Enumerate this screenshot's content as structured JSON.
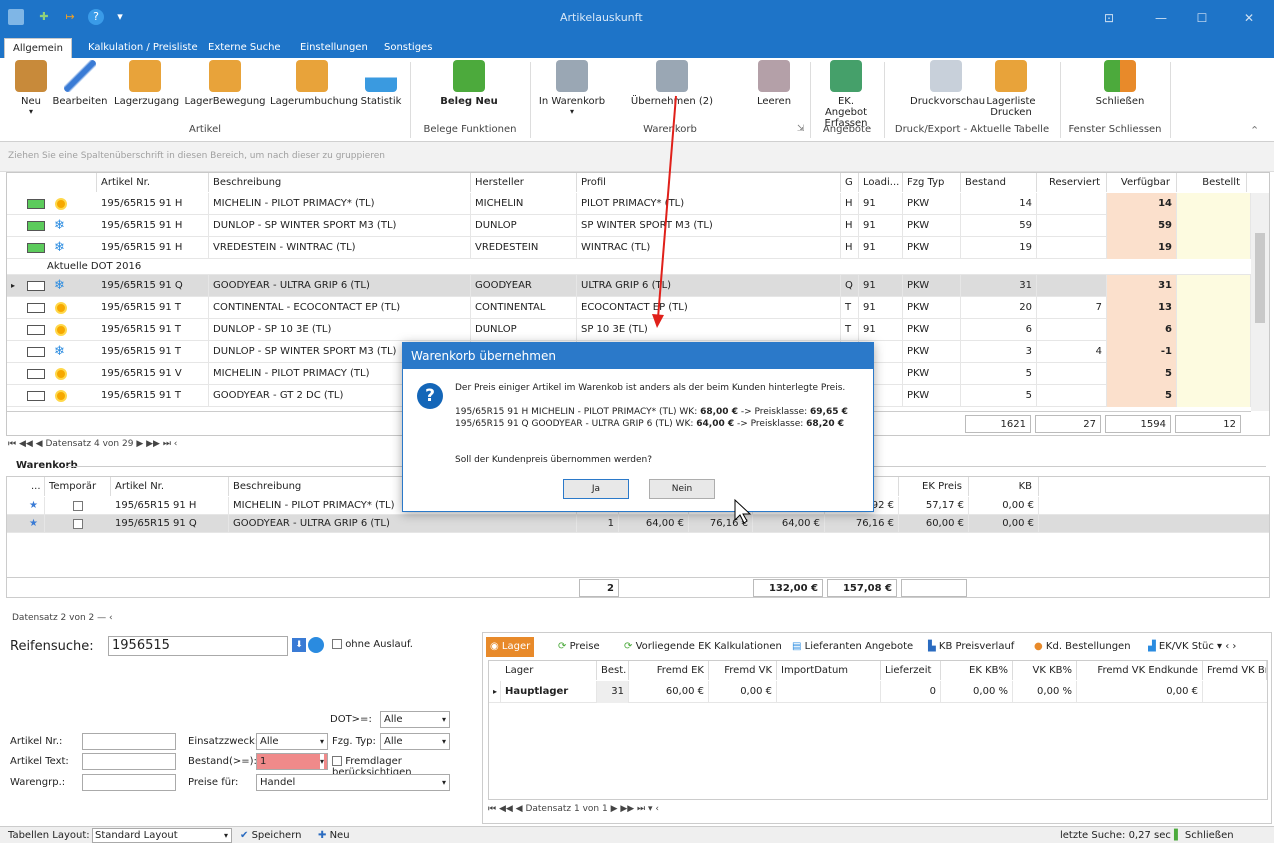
{
  "window": {
    "title": "Artikelauskunft"
  },
  "tabs": [
    "Allgemein",
    "Kalkulation / Preisliste",
    "Externe Suche",
    "Einstellungen",
    "Sonstiges"
  ],
  "ribbon": {
    "buttons": {
      "neu": "Neu",
      "bearbeiten": "Bearbeiten",
      "lagerzugang": "Lagerzugang",
      "lagerbewegung": "LagerBewegung",
      "lagerumbuchung": "Lagerumbuchung",
      "statistik": "Statistik",
      "beleg_neu": "Beleg Neu",
      "in_warenkorb": "In Warenkorb",
      "uebernehmen": "Übernehmen (2)",
      "leeren": "Leeren",
      "ek_angebot_1": "EK. Angebot",
      "ek_angebot_2": "Erfassen",
      "druckvorschau": "Druckvorschau",
      "lagerliste_1": "Lagerliste",
      "lagerliste_2": "Drucken",
      "schliessen": "Schließen"
    },
    "groups": {
      "artikel": "Artikel",
      "belege": "Belege Funktionen",
      "warenkorb": "Warenkorb",
      "angebote": "Angebote",
      "druck": "Druck/Export - Aktuelle Tabelle",
      "fenster": "Fenster Schliessen"
    }
  },
  "groupbar_hint": "Ziehen Sie eine Spaltenüberschrift in diesen Bereich, um nach dieser zu gruppieren",
  "main_grid": {
    "headers": {
      "artikel": "Artikel Nr.",
      "beschreibung": "Beschreibung",
      "hersteller": "Hersteller",
      "profil": "Profil",
      "g": "G",
      "loading": "Loadi...",
      "fzg": "Fzg Typ",
      "bestand": "Bestand",
      "reserviert": "Reserviert",
      "verfuegbar": "Verfügbar",
      "bestellt": "Bestellt"
    },
    "group_row": "Aktuelle DOT 2016",
    "rows": [
      {
        "artikel": "195/65R15 91 H",
        "beschreibung": "MICHELIN - PILOT PRIMACY* (TL)",
        "hersteller": "MICHELIN",
        "profil": "PILOT PRIMACY* (TL)",
        "g": "H",
        "loading": "91",
        "fzg": "PKW",
        "bestand": "14",
        "reserviert": "",
        "verfuegbar": "14"
      },
      {
        "artikel": "195/65R15 91 H",
        "beschreibung": "DUNLOP - SP WINTER SPORT M3 (TL)",
        "hersteller": "DUNLOP",
        "profil": "SP WINTER SPORT M3 (TL)",
        "g": "H",
        "loading": "91",
        "fzg": "PKW",
        "bestand": "59",
        "reserviert": "",
        "verfuegbar": "59"
      },
      {
        "artikel": "195/65R15 91 H",
        "beschreibung": "VREDESTEIN - WINTRAC (TL)",
        "hersteller": "VREDESTEIN",
        "profil": "WINTRAC (TL)",
        "g": "H",
        "loading": "91",
        "fzg": "PKW",
        "bestand": "19",
        "reserviert": "",
        "verfuegbar": "19"
      },
      {
        "artikel": "195/65R15 91 Q",
        "beschreibung": "GOODYEAR - ULTRA GRIP 6 (TL)",
        "hersteller": "GOODYEAR",
        "profil": "ULTRA GRIP 6 (TL)",
        "g": "Q",
        "loading": "91",
        "fzg": "PKW",
        "bestand": "31",
        "reserviert": "",
        "verfuegbar": "31"
      },
      {
        "artikel": "195/65R15 91 T",
        "beschreibung": "CONTINENTAL - ECOCONTACT EP (TL)",
        "hersteller": "CONTINENTAL",
        "profil": "ECOCONTACT EP (TL)",
        "g": "T",
        "loading": "91",
        "fzg": "PKW",
        "bestand": "20",
        "reserviert": "7",
        "verfuegbar": "13"
      },
      {
        "artikel": "195/65R15 91 T",
        "beschreibung": "DUNLOP - SP 10 3E (TL)",
        "hersteller": "DUNLOP",
        "profil": "SP 10 3E (TL)",
        "g": "T",
        "loading": "91",
        "fzg": "PKW",
        "bestand": "6",
        "reserviert": "",
        "verfuegbar": "6"
      },
      {
        "artikel": "195/65R15 91 T",
        "beschreibung": "DUNLOP - SP WINTER SPORT M3 (TL)",
        "hersteller": "",
        "profil": "",
        "g": "",
        "loading": "",
        "fzg": "PKW",
        "bestand": "3",
        "reserviert": "4",
        "verfuegbar": "-1"
      },
      {
        "artikel": "195/65R15 91 V",
        "beschreibung": "MICHELIN - PILOT PRIMACY (TL)",
        "hersteller": "",
        "profil": "",
        "g": "",
        "loading": "",
        "fzg": "PKW",
        "bestand": "5",
        "reserviert": "",
        "verfuegbar": "5"
      },
      {
        "artikel": "195/65R15 91 T",
        "beschreibung": "GOODYEAR - GT 2 DC (TL)",
        "hersteller": "",
        "profil": "",
        "g": "",
        "loading": "",
        "fzg": "PKW",
        "bestand": "5",
        "reserviert": "",
        "verfuegbar": "5"
      }
    ],
    "totals": {
      "bestand": "1621",
      "reserviert": "27",
      "verfuegbar": "1594",
      "bestellt": "12"
    },
    "nav": "Datensatz 4 von 29"
  },
  "warenkorb": {
    "title": "Warenkorb",
    "headers": {
      "dots": "...",
      "temporaer": "Temporär",
      "artikel": "Artikel Nr.",
      "beschreibung": "Beschreibung",
      "brutto": "utto",
      "ek": "EK Preis",
      "kb": "KB"
    },
    "rows": [
      {
        "artikel": "195/65R15 91 H",
        "beschreibung": "MICHELIN - PILOT PRIMACY* (TL)",
        "menge": "",
        "preis": "",
        "p2": "",
        "p3": "",
        "brutto": "92 €",
        "ek": "57,17 €",
        "kb": "0,00 €"
      },
      {
        "artikel": "195/65R15 91 Q",
        "beschreibung": "GOODYEAR - ULTRA GRIP 6 (TL)",
        "menge": "1",
        "preis": "64,00 €",
        "p2": "76,16 €",
        "p3": "64,00 €",
        "brutto": "76,16 €",
        "ek": "60,00 €",
        "kb": "0,00 €"
      }
    ],
    "totals": {
      "menge": "2",
      "netto": "132,00 €",
      "brutto": "157,08 €"
    },
    "nav": "Datensatz 2 von 2"
  },
  "dialog": {
    "title": "Warenkorb übernehmen",
    "line1": "Der Preis einiger Artikel im Warenkob ist anders als der beim Kunden hinterlegte Preis.",
    "line2a": "195/65R15 91 H MICHELIN - PILOT PRIMACY* (TL) WK: ",
    "line2b": "68,00 €",
    "line2c": " -> Preisklasse: ",
    "line2d": "69,65 €",
    "line3a": "195/65R15 91 Q GOODYEAR - ULTRA GRIP 6 (TL) WK: ",
    "line3b": "64,00 €",
    "line3c": " -> Preisklasse: ",
    "line3d": "68,20 €",
    "question": "Soll der Kundenpreis übernommen werden?",
    "yes": "Ja",
    "no": "Nein"
  },
  "search": {
    "label": "Reifensuche:",
    "value": "1956515",
    "ohne_auslauf": "ohne Auslauf.",
    "dot_label": "DOT>=:",
    "dot_value": "Alle",
    "artikel_nr": "Artikel Nr.:",
    "artikel_text": "Artikel Text:",
    "warengrp": "Warengrp.:",
    "einsatz_label": "Einsatzzweck:",
    "einsatz_value": "Alle",
    "fzg_label": "Fzg. Typ:",
    "fzg_value": "Alle",
    "bestand_label": "Bestand(>=):",
    "bestand_value": "1",
    "fremdlager": "Fremdlager berücksichtigen",
    "preise_label": "Preise für:",
    "preise_value": "Handel"
  },
  "detail": {
    "tabs": [
      "Lager",
      "Preise",
      "Vorliegende EK Kalkulationen",
      "Lieferanten Angebote",
      "KB Preisverlauf",
      "Kd. Bestellungen",
      "EK/VK Stüc"
    ],
    "headers": {
      "lager": "Lager",
      "best": "Best.",
      "fremd_ek": "Fremd EK",
      "fremd_vk": "Fremd VK",
      "import": "ImportDatum",
      "lieferzeit": "Lieferzeit",
      "ek_kb": "EK KB%",
      "vk_kb": "VK KB%",
      "vk_end": "Fremd VK Endkunde",
      "vk_bru": "Fremd VK Bru"
    },
    "row": {
      "lager": "Hauptlager",
      "best": "31",
      "fremd_ek": "60,00 €",
      "fremd_vk": "0,00 €",
      "import": "",
      "lieferzeit": "0",
      "ek_kb": "0,00 %",
      "vk_kb": "0,00 %",
      "vk_end": "0,00 €"
    },
    "nav": "Datensatz 1 von 1"
  },
  "status": {
    "layout_label": "Tabellen Layout:",
    "layout_value": "Standard Layout",
    "speichern": "Speichern",
    "neu": "Neu",
    "letzte": "letzte Suche: 0,27 sec",
    "schliessen": "Schließen"
  },
  "colors": {
    "accent": "#1e74c8",
    "available": "#fbe0cc",
    "arrow": "#e0201a"
  }
}
